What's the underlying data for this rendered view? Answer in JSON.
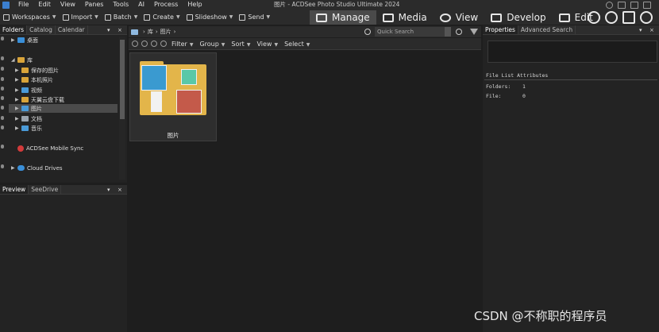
{
  "menubar": {
    "items": [
      "File",
      "Edit",
      "View",
      "Panes",
      "Tools",
      "AI",
      "Process",
      "Help"
    ],
    "title": "图片 - ACDSee Photo Studio Ultimate 2024"
  },
  "toolbar": {
    "workspaces": "Workspaces",
    "import": "Import",
    "batch": "Batch",
    "create": "Create",
    "slideshow": "Slideshow",
    "send": "Send"
  },
  "modes": [
    "Manage",
    "Media",
    "View",
    "Develop",
    "Edit"
  ],
  "left_panel": {
    "tabs": [
      "Folders",
      "Catalog",
      "Calendar"
    ],
    "pin": "▾",
    "close": "×",
    "tree": [
      {
        "label": "桌面",
        "expand": "▶"
      },
      {
        "label": "库",
        "expand": "◢"
      },
      {
        "label": "保存的图片",
        "expand": "▶"
      },
      {
        "label": "本机照片",
        "expand": "▶"
      },
      {
        "label": "视频",
        "expand": "▶"
      },
      {
        "label": "天翼云盘下载",
        "expand": "▶"
      },
      {
        "label": "图片",
        "expand": "▶"
      },
      {
        "label": "文档",
        "expand": "▶"
      },
      {
        "label": "音乐",
        "expand": "▶"
      },
      {
        "label": "ACDSee Mobile Sync",
        "expand": ""
      },
      {
        "label": "Cloud Drives",
        "expand": "▶"
      }
    ]
  },
  "preview_panel": {
    "tabs": [
      "Preview",
      "SeeDrive"
    ],
    "pin": "▾",
    "close": "×"
  },
  "address": {
    "crumbs": [
      "库",
      "图片"
    ],
    "sep": "›",
    "search_placeholder": "Quick Search"
  },
  "filterbar": [
    "Filter",
    "Group",
    "Sort",
    "View",
    "Select"
  ],
  "thumbnail": {
    "label": "图片"
  },
  "right_panel": {
    "tabs": [
      "Properties",
      "Advanced Search"
    ],
    "pin": "▾",
    "close": "×",
    "section": "File List Attributes",
    "rows": [
      {
        "key": "Folders:",
        "value": "1"
      },
      {
        "key": "File:",
        "value": "0"
      }
    ]
  },
  "watermark": "CSDN @不称职的程序员"
}
